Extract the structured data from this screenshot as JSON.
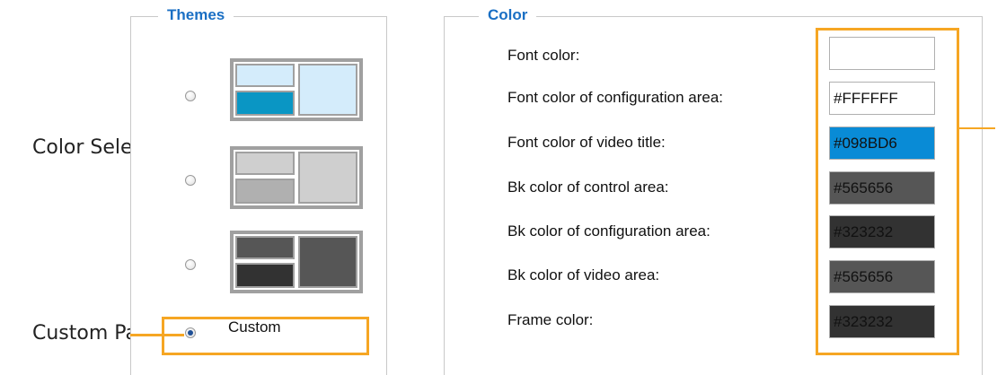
{
  "callouts": {
    "color_selector": "Color Selector",
    "custom_panel": "Custom Panel"
  },
  "themes": {
    "legend": "Themes",
    "custom_label": "Custom",
    "selected": "Custom",
    "options": [
      {
        "name": "theme-1",
        "frame": "#a0a0a0",
        "tl": "#d4ecfb",
        "bl": "#0a96c4",
        "r": "#d4ecfb",
        "inner_border": "#a0a0a0"
      },
      {
        "name": "theme-2",
        "frame": "#a0a0a0",
        "tl": "#cfcfcf",
        "bl": "#b0b0b0",
        "r": "#cfcfcf",
        "inner_border": "#a0a0a0"
      },
      {
        "name": "theme-3",
        "frame": "#a0a0a0",
        "tl": "#565656",
        "bl": "#323232",
        "r": "#565656",
        "inner_border": "#a0a0a0"
      }
    ]
  },
  "color": {
    "legend": "Color",
    "rows": [
      {
        "label": "Font color:",
        "value": "",
        "bg": "#ffffff",
        "fg": "#111111"
      },
      {
        "label": "Font color of configuration area:",
        "value": "#FFFFFF",
        "bg": "#ffffff",
        "fg": "#111111"
      },
      {
        "label": "Font color of video title:",
        "value": "#098BD6",
        "bg": "#098BD6",
        "fg": "#111111"
      },
      {
        "label": "Bk color of control area:",
        "value": "#565656",
        "bg": "#565656",
        "fg": "#111111"
      },
      {
        "label": "Bk color of configuration area:",
        "value": "#323232",
        "bg": "#323232",
        "fg": "#111111"
      },
      {
        "label": "Bk color of video area:",
        "value": "#565656",
        "bg": "#565656",
        "fg": "#111111"
      },
      {
        "label": "Frame color:",
        "value": "#323232",
        "bg": "#323232",
        "fg": "#111111"
      }
    ]
  },
  "accent": {
    "highlight": "#f6a623",
    "legend": "#1a6fc4"
  }
}
